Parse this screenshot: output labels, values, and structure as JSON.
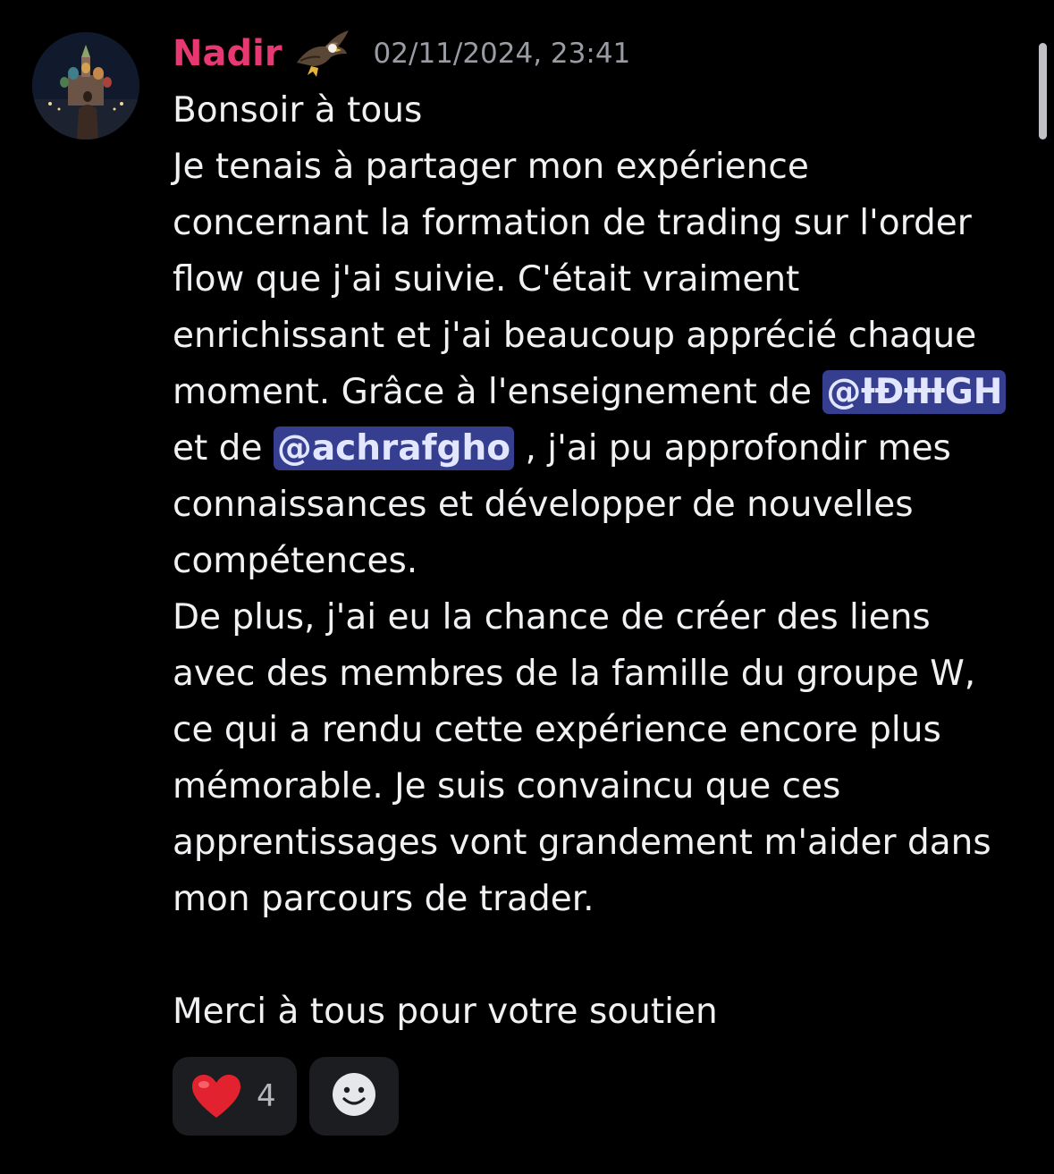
{
  "message": {
    "author": "Nadir",
    "author_badge_icon": "eagle-icon",
    "timestamp": "02/11/2024, 23:41",
    "colors": {
      "author": "#e83872",
      "mention_bg": "#353e8f",
      "background": "#000000"
    },
    "lines": {
      "l1": "Bonsoir à tous",
      "l2": "Je tenais à partager mon expérience",
      "l3": "concernant la formation de trading sur l'order",
      "l4": "flow que j'ai suivie. C'était vraiment",
      "l5": "enrichissant et j'ai beaucoup apprécié chaque",
      "l6_pre": "moment. Grâce à l'enseignement de ",
      "l7_pre": "et de ",
      "l7_post": " , j'ai pu approfondir mes",
      "l8": "connaissances et développer de nouvelles",
      "l9": "compétences.",
      "l10": "De plus, j'ai eu la chance de créer des liens",
      "l11": "avec des membres de la famille du groupe W,",
      "l12": "ce qui a rendu cette expérience encore plus",
      "l13": "mémorable. Je suis convaincu que ces",
      "l14": "apprentissages vont grandement m'aider dans",
      "l15": "mon parcours de trader.",
      "l16": "Merci à tous pour votre soutien"
    },
    "mentions": {
      "first": "@ƗĐƗƗƗGH",
      "second": "@achrafgho"
    }
  },
  "reactions": [
    {
      "emoji": "heart-icon",
      "count": "4"
    }
  ],
  "add_reaction_icon": "smiley-icon"
}
